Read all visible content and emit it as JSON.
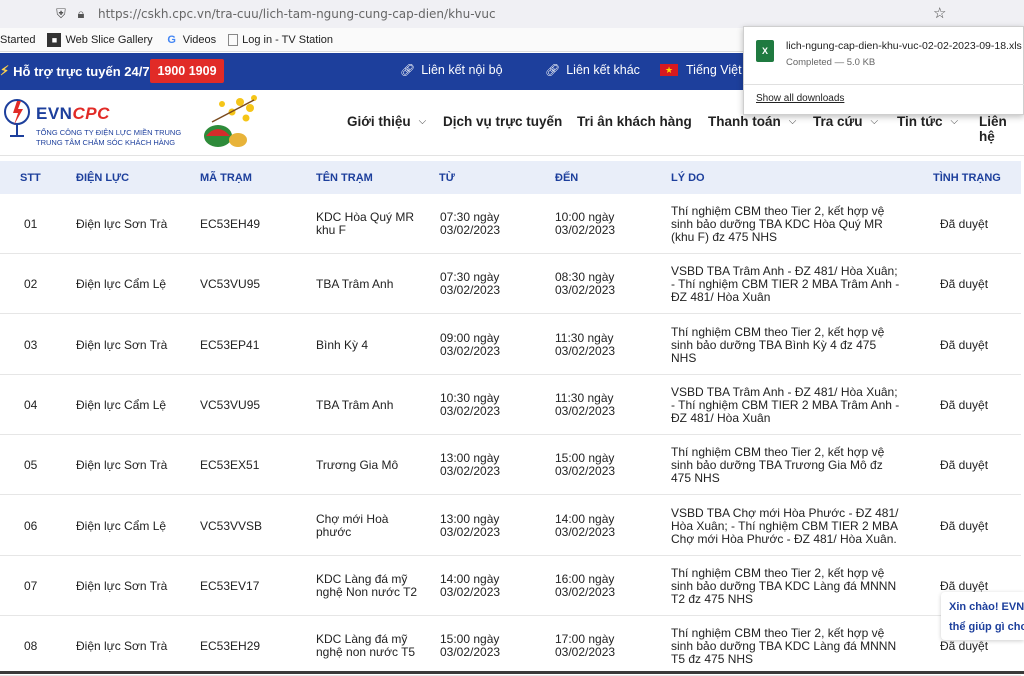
{
  "browser": {
    "url": "https://cskh.cpc.vn/tra-cuu/lich-tam-ngung-cung-cap-dien/khu-vuc",
    "bookmarks": [
      {
        "label": "Started",
        "icon": ""
      },
      {
        "label": "Web Slice Gallery",
        "icon": "web-slice-icon"
      },
      {
        "label": "Videos",
        "icon": "google-icon"
      },
      {
        "label": "Log in - TV Station",
        "icon": "page-icon"
      }
    ]
  },
  "download": {
    "filename": "lich-ngung-cap-dien-khu-vuc-02-02-2023-09-18.xls",
    "status": "Completed — 5.0 KB",
    "show_all": "Show all downloads"
  },
  "topbar": {
    "support_label": "Hỗ trợ trực tuyến 24/7:",
    "hotline": "1900 1909",
    "link_internal": "Liên kết nội bộ",
    "link_other": "Liên kết khác",
    "language": "Tiếng Việt"
  },
  "logo": {
    "name_evn": "EVN",
    "name_cpc": "CPC",
    "line1": "TỔNG CÔNG TY ĐIỆN LỰC MIỀN TRUNG",
    "line2": "TRUNG TÂM CHĂM SÓC KHÁCH HÀNG"
  },
  "menu": [
    {
      "label": "Giới thiệu",
      "chevron": true
    },
    {
      "label": "Dịch vụ trực tuyến",
      "chevron": false
    },
    {
      "label": "Tri ân khách hàng",
      "chevron": false
    },
    {
      "label": "Thanh toán",
      "chevron": true
    },
    {
      "label": "Tra cứu",
      "chevron": true
    },
    {
      "label": "Tin tức",
      "chevron": true
    },
    {
      "label": "Liên hệ",
      "chevron": false
    }
  ],
  "table": {
    "headers": [
      "STT",
      "ĐIỆN LỰC",
      "MÃ TRẠM",
      "TÊN TRẠM",
      "TỪ",
      "ĐẾN",
      "LÝ DO",
      "TÌNH TRẠNG"
    ],
    "rows": [
      {
        "stt": "01",
        "dien_luc": "Điện lực Sơn Trà",
        "ma_tram": "EC53EH49",
        "ten_tram": [
          "KDC Hòa Quý MR",
          "khu F"
        ],
        "tu": [
          "07:30 ngày",
          "03/02/2023"
        ],
        "den": [
          "10:00 ngày",
          "03/02/2023"
        ],
        "ly_do": [
          "Thí nghiệm CBM theo Tier 2, kết hợp vệ",
          "sinh bảo dưỡng TBA KDC Hòa Quý MR",
          "(khu F) đz 475 NHS"
        ],
        "tinh_trang": "Đã duyệt"
      },
      {
        "stt": "02",
        "dien_luc": "Điện lực Cẩm Lệ",
        "ma_tram": "VC53VU95",
        "ten_tram": [
          "TBA Trâm Anh"
        ],
        "tu": [
          "07:30 ngày",
          "03/02/2023"
        ],
        "den": [
          "08:30 ngày",
          "03/02/2023"
        ],
        "ly_do": [
          "VSBD TBA Trâm Anh - ĐZ 481/ Hòa Xuân;",
          "- Thí nghiệm CBM TIER 2 MBA Trâm Anh -",
          "ĐZ 481/ Hòa Xuân"
        ],
        "tinh_trang": "Đã duyệt"
      },
      {
        "stt": "03",
        "dien_luc": "Điện lực Sơn Trà",
        "ma_tram": "EC53EP41",
        "ten_tram": [
          "Bình Kỳ 4"
        ],
        "tu": [
          "09:00 ngày",
          "03/02/2023"
        ],
        "den": [
          "11:30 ngày",
          "03/02/2023"
        ],
        "ly_do": [
          "Thí nghiệm CBM theo Tier 2, kết hợp vệ",
          "sinh bảo dưỡng TBA Bình Kỳ 4 đz 475",
          "NHS"
        ],
        "tinh_trang": "Đã duyệt"
      },
      {
        "stt": "04",
        "dien_luc": "Điện lực Cẩm Lệ",
        "ma_tram": "VC53VU95",
        "ten_tram": [
          "TBA Trâm Anh"
        ],
        "tu": [
          "10:30 ngày",
          "03/02/2023"
        ],
        "den": [
          "11:30 ngày",
          "03/02/2023"
        ],
        "ly_do": [
          "VSBD TBA Trâm Anh - ĐZ 481/ Hòa Xuân;",
          "- Thí nghiệm CBM TIER 2 MBA Trâm Anh -",
          "ĐZ 481/ Hòa Xuân"
        ],
        "tinh_trang": "Đã duyệt"
      },
      {
        "stt": "05",
        "dien_luc": "Điện lực Sơn Trà",
        "ma_tram": "EC53EX51",
        "ten_tram": [
          "Trương Gia Mô"
        ],
        "tu": [
          "13:00 ngày",
          "03/02/2023"
        ],
        "den": [
          "15:00 ngày",
          "03/02/2023"
        ],
        "ly_do": [
          "Thí nghiệm CBM theo Tier 2, kết hợp vệ",
          "sinh bảo dưỡng TBA Trương Gia Mô đz",
          "475 NHS"
        ],
        "tinh_trang": "Đã duyệt"
      },
      {
        "stt": "06",
        "dien_luc": "Điện lực Cẩm Lệ",
        "ma_tram": "VC53VVSB",
        "ten_tram": [
          "Chợ mới Hoà",
          "phước"
        ],
        "tu": [
          "13:00 ngày",
          "03/02/2023"
        ],
        "den": [
          "14:00 ngày",
          "03/02/2023"
        ],
        "ly_do": [
          "VSBD TBA Chợ mới Hòa Phước - ĐZ 481/",
          "Hòa Xuân; - Thí nghiệm CBM TIER 2 MBA",
          "Chợ mới Hòa Phước - ĐZ 481/ Hòa Xuân."
        ],
        "tinh_trang": "Đã duyệt"
      },
      {
        "stt": "07",
        "dien_luc": "Điện lực Sơn Trà",
        "ma_tram": "EC53EV17",
        "ten_tram": [
          "KDC Làng đá mỹ",
          "nghệ Non nước T2"
        ],
        "tu": [
          "14:00 ngày",
          "03/02/2023"
        ],
        "den": [
          "16:00 ngày",
          "03/02/2023"
        ],
        "ly_do": [
          "Thí nghiệm CBM theo Tier 2, kết hợp vệ",
          "sinh bảo dưỡng TBA KDC Làng đá MNNN",
          "T2 đz 475 NHS"
        ],
        "tinh_trang": "Đã duyệt"
      },
      {
        "stt": "08",
        "dien_luc": "Điện lực Sơn Trà",
        "ma_tram": "EC53EH29",
        "ten_tram": [
          "KDC Làng đá mỹ",
          "nghệ non nước T5"
        ],
        "tu": [
          "15:00 ngày",
          "03/02/2023"
        ],
        "den": [
          "17:00 ngày",
          "03/02/2023"
        ],
        "ly_do": [
          "Thí nghiệm CBM theo Tier 2, kết hợp vệ",
          "sinh bảo dưỡng TBA KDC Làng đá MNNN",
          "T5 đz 475 NHS"
        ],
        "tinh_trang": "Đã duyệt"
      }
    ]
  },
  "chat": {
    "line1": "Xin chào! EVN",
    "line2": "thể giúp gì cho"
  },
  "colors": {
    "brand_blue": "#1d3f9c",
    "brand_red": "#e12b27",
    "header_row": "#e9eef9"
  }
}
